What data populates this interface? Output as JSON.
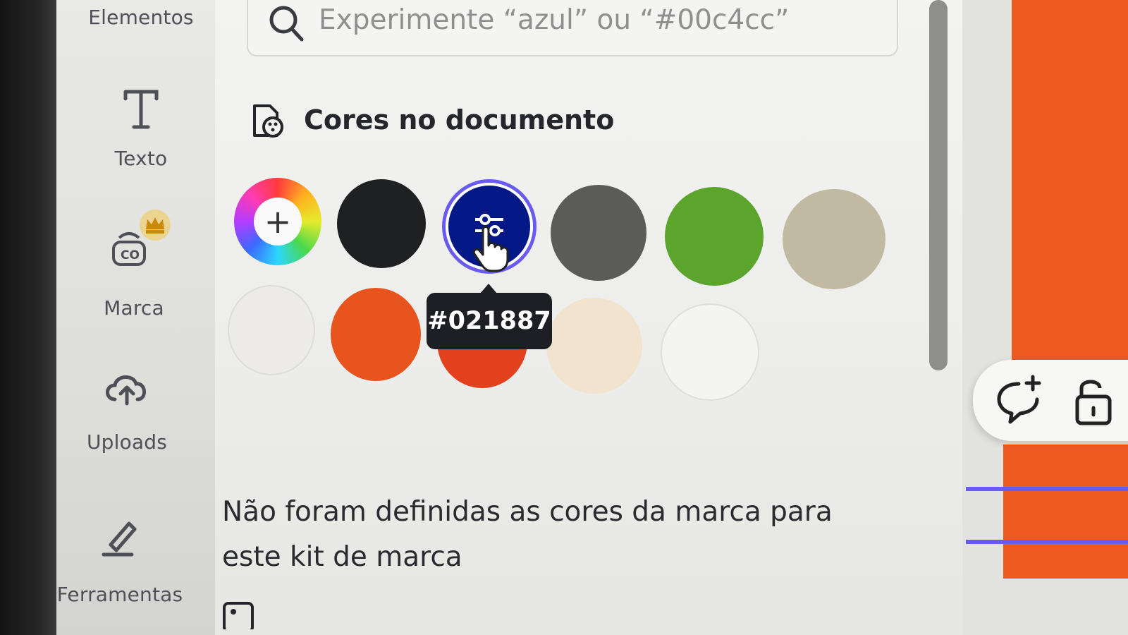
{
  "sidebar": {
    "items": [
      {
        "id": "elements",
        "label": "Elementos",
        "icon": "elements-icon"
      },
      {
        "id": "text",
        "label": "Texto",
        "icon": "text-t-icon"
      },
      {
        "id": "brand",
        "label": "Marca",
        "icon": "brand-kit-icon",
        "badge_icon": "crown-icon"
      },
      {
        "id": "uploads",
        "label": "Uploads",
        "icon": "cloud-upload-icon"
      },
      {
        "id": "tools",
        "label": "Ferramentas",
        "icon": "pen-tool-icon"
      }
    ]
  },
  "color_panel": {
    "search": {
      "placeholder": "Experimente “azul” ou “#00c4cc”",
      "value": ""
    },
    "document_colors": {
      "title": "Cores no documento",
      "icon": "palette-document-icon",
      "add_label": "+",
      "swatches": [
        {
          "color": "#1f2022"
        },
        {
          "color": "#021887",
          "selected": true
        },
        {
          "color": "#5b5b5a"
        },
        {
          "color": "#5ba52c"
        },
        {
          "color": "#c1b9a2"
        },
        {
          "color": "#ecebe8"
        },
        {
          "color": "#e8541e"
        },
        {
          "color": "#e3401d"
        },
        {
          "color": "#f1e3ce"
        },
        {
          "color": "#f4f4f2"
        }
      ],
      "tooltip": "#021887"
    },
    "brand_colors_message": "Não foram definidas as cores da marca para este kit de marca"
  },
  "canvas_toolbar": {
    "icons": [
      "add-comment-icon",
      "lock-icon"
    ]
  },
  "colors": {
    "selection_accent": "#6a5bf0",
    "canvas_orange": "#ef5a20"
  }
}
